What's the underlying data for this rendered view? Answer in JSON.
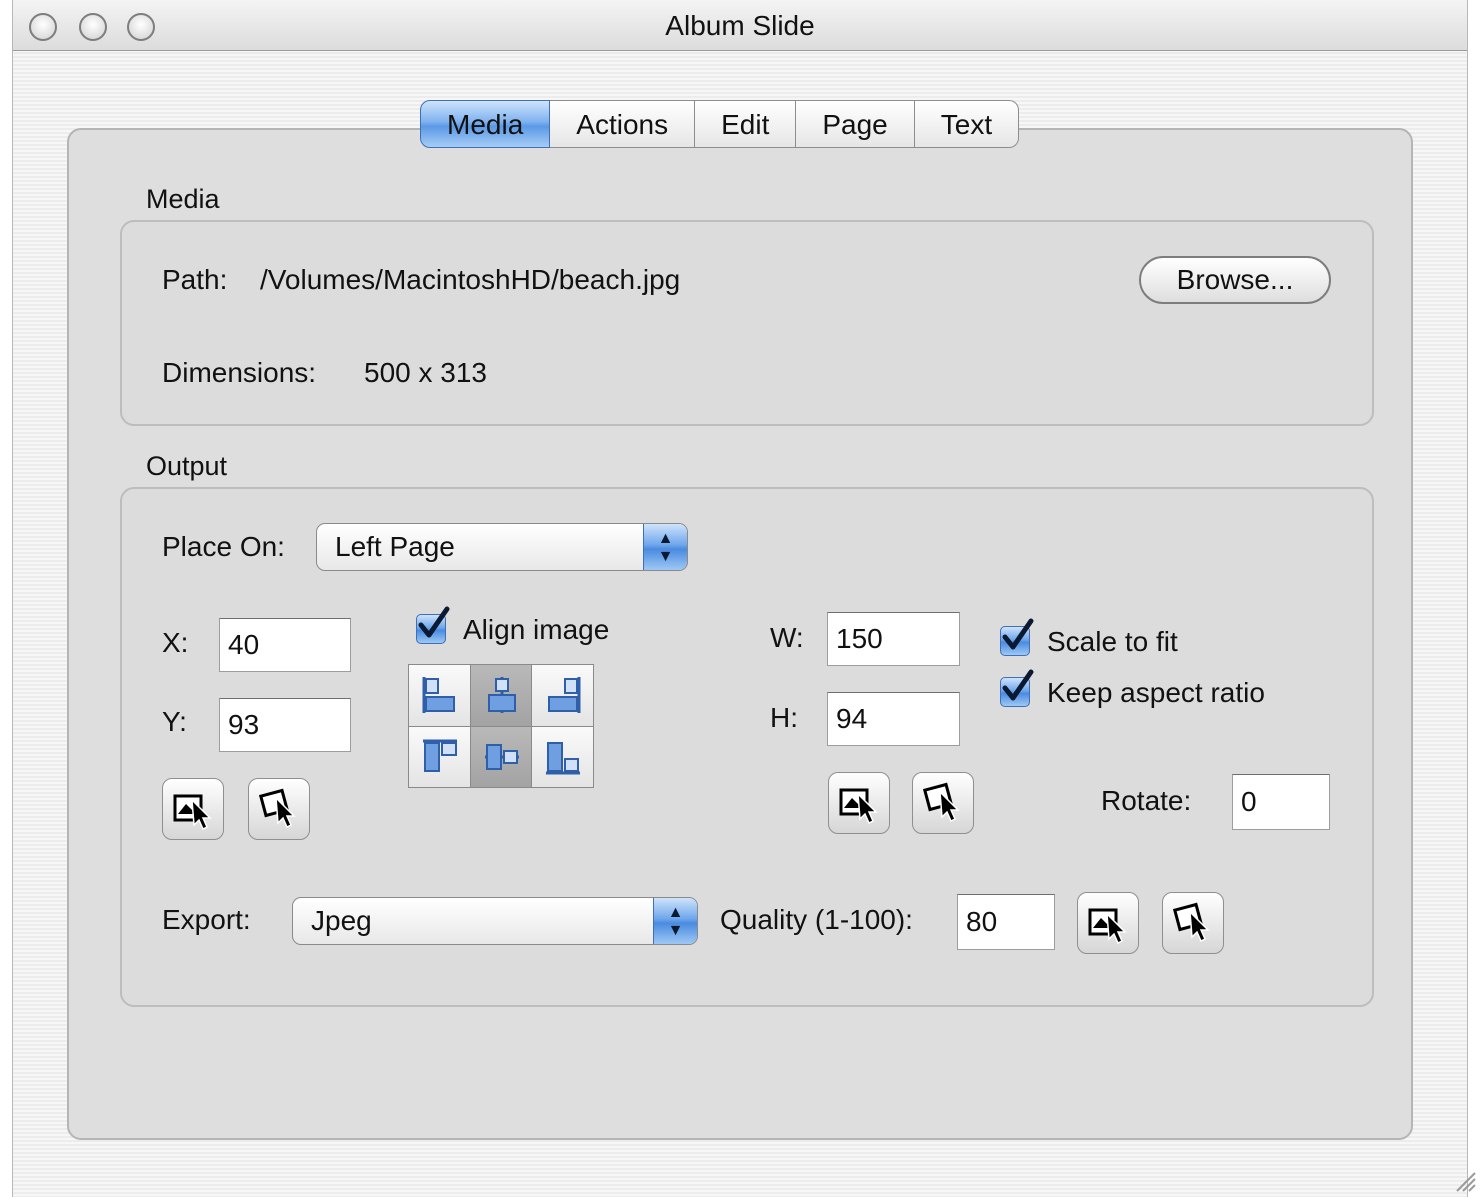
{
  "window": {
    "title": "Album Slide"
  },
  "tabs": [
    {
      "label": "Media",
      "active": true
    },
    {
      "label": "Actions",
      "active": false
    },
    {
      "label": "Edit",
      "active": false
    },
    {
      "label": "Page",
      "active": false
    },
    {
      "label": "Text",
      "active": false
    }
  ],
  "media": {
    "group_label": "Media",
    "path_label": "Path:",
    "path_value": "/Volumes/MacintoshHD/beach.jpg",
    "browse_label": "Browse...",
    "dimensions_label": "Dimensions:",
    "dimensions_value": "500 x 313"
  },
  "output": {
    "group_label": "Output",
    "place_on_label": "Place On:",
    "place_on_value": "Left Page",
    "x_label": "X:",
    "x_value": "40",
    "y_label": "Y:",
    "y_value": "93",
    "align_image_label": "Align image",
    "align_image_checked": true,
    "align_selected": [
      "top-center",
      "middle-center"
    ],
    "w_label": "W:",
    "w_value": "150",
    "h_label": "H:",
    "h_value": "94",
    "scale_to_fit_label": "Scale to fit",
    "scale_to_fit_checked": true,
    "keep_aspect_label": "Keep aspect ratio",
    "keep_aspect_checked": true,
    "rotate_label": "Rotate:",
    "rotate_value": "0",
    "export_label": "Export:",
    "export_value": "Jpeg",
    "quality_label": "Quality (1-100):",
    "quality_value": "80"
  },
  "colors": {
    "accent": "#5b99e6",
    "panel": "#dedede"
  }
}
